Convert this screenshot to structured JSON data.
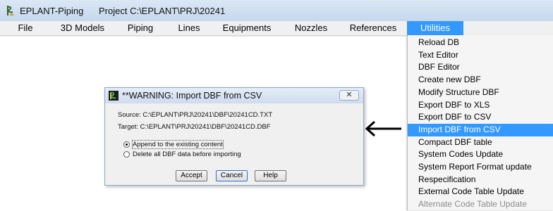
{
  "window": {
    "app_title": "EPLANT-Piping",
    "project_label": "Project C:\\EPLANT\\PRJ\\20241",
    "app_icon": "eplant-logo-icon"
  },
  "menubar": {
    "items": [
      {
        "label": "File"
      },
      {
        "label": "3D Models"
      },
      {
        "label": "Piping"
      },
      {
        "label": "Lines"
      },
      {
        "label": "Equipments"
      },
      {
        "label": "Nozzles"
      },
      {
        "label": "References"
      },
      {
        "label": "Utilities",
        "active": true
      }
    ]
  },
  "utilities_menu": {
    "items": [
      {
        "label": "Reload DB"
      },
      {
        "label": "Text Editor"
      },
      {
        "label": "DBF Editor"
      },
      {
        "label": "Create new DBF"
      },
      {
        "label": "Modify Structure DBF"
      },
      {
        "label": "Export DBF to XLS"
      },
      {
        "label": "Export DBF to CSV"
      },
      {
        "label": "Import DBF from CSV",
        "highlighted": true
      },
      {
        "label": "Compact DBF table"
      },
      {
        "label": "System Codes Update"
      },
      {
        "label": "System Report Format update"
      },
      {
        "label": "Respecification"
      },
      {
        "label": "External Code Table Update"
      },
      {
        "label": "Alternate Code Table Update",
        "disabled": true
      }
    ]
  },
  "dialog": {
    "title": "**WARNING: Import DBF from CSV",
    "source_text": "Source: C:\\EPLANT\\PRJ\\20241\\DBF\\20241CD.TXT",
    "target_text": "Target: C:\\EPLANT\\PRJ\\20241\\DBF\\20241CD.DBF",
    "options": [
      {
        "label": "Append to the existing content",
        "checked": true
      },
      {
        "label": "Delete all DBF data before importing",
        "checked": false
      }
    ],
    "buttons": {
      "accept": "Accept",
      "cancel": "Cancel",
      "help": "Help"
    },
    "close_icon": "close-icon"
  },
  "colors": {
    "highlight": "#3399ff",
    "menubar_bg": "#f0f0f0",
    "disabled_text": "#8c8c8c"
  }
}
